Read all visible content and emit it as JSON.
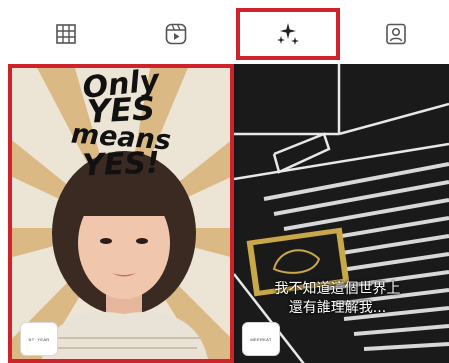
{
  "tabs": [
    {
      "icon": "grid-icon",
      "selected": false
    },
    {
      "icon": "reels-icon",
      "selected": false
    },
    {
      "icon": "effects-sparkle-icon",
      "selected": true
    },
    {
      "icon": "tagged-person-icon",
      "selected": false
    }
  ],
  "colors": {
    "highlight": "#d0222a",
    "icon": "#555555",
    "selected_icon": "#222222"
  },
  "grid": {
    "items": [
      {
        "overlay_lines": [
          "Only",
          "YES",
          "means",
          "YES!"
        ],
        "avatar_label": "NT· YEAR"
      },
      {
        "subtitle_lines": [
          "我不知道這個世界上",
          "還有誰理解我..."
        ],
        "avatar_label": "MEERKAT"
      }
    ]
  }
}
